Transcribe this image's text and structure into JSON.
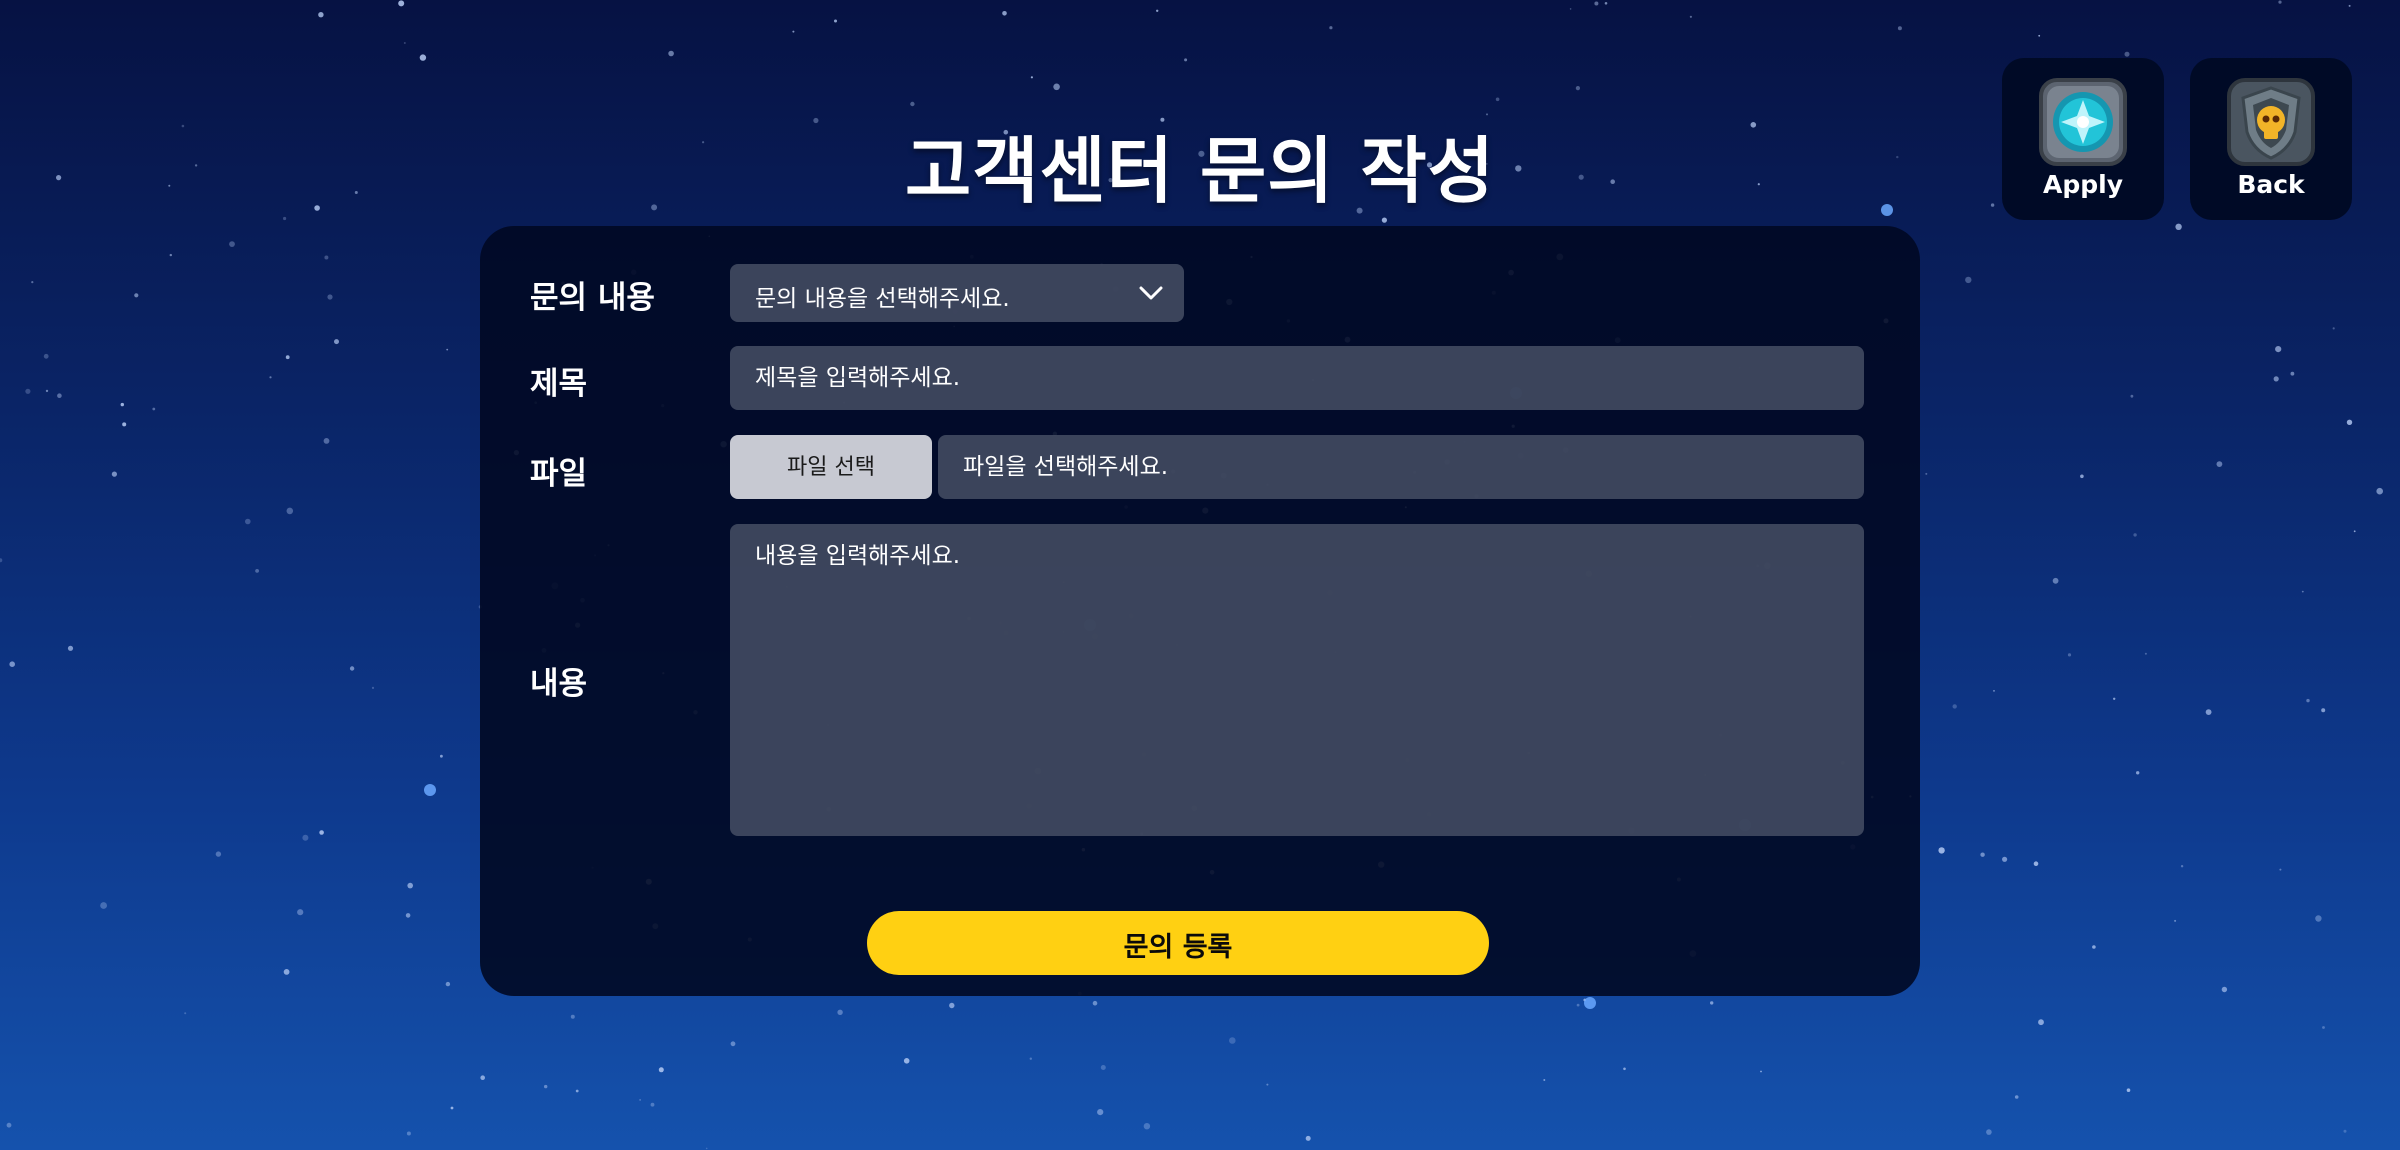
{
  "page": {
    "title": "고객센터 문의 작성"
  },
  "top_buttons": {
    "apply": {
      "label": "Apply",
      "icon": "ice-crystal-badge-icon"
    },
    "back": {
      "label": "Back",
      "icon": "skull-shield-badge-icon"
    }
  },
  "form": {
    "inquiry_type": {
      "label": "문의 내용",
      "selected_text": "문의 내용을 선택해주세요.",
      "icon": "chevron-down-icon"
    },
    "subject": {
      "label": "제목",
      "placeholder": "제목을 입력해주세요."
    },
    "file": {
      "label": "파일",
      "button_label": "파일 선택",
      "placeholder": "파일을 선택해주세요."
    },
    "content": {
      "label": "내용",
      "placeholder": "내용을 입력해주세요."
    },
    "submit_label": "문의 등록"
  },
  "colors": {
    "background_top": "#061243",
    "background_bottom": "#1552ad",
    "panel": "#010924",
    "field": "#485066",
    "file_button": "#c7c9d2",
    "submit": "#ffd012",
    "badge_teal": "#22c4d8",
    "badge_gold": "#f2b428"
  }
}
